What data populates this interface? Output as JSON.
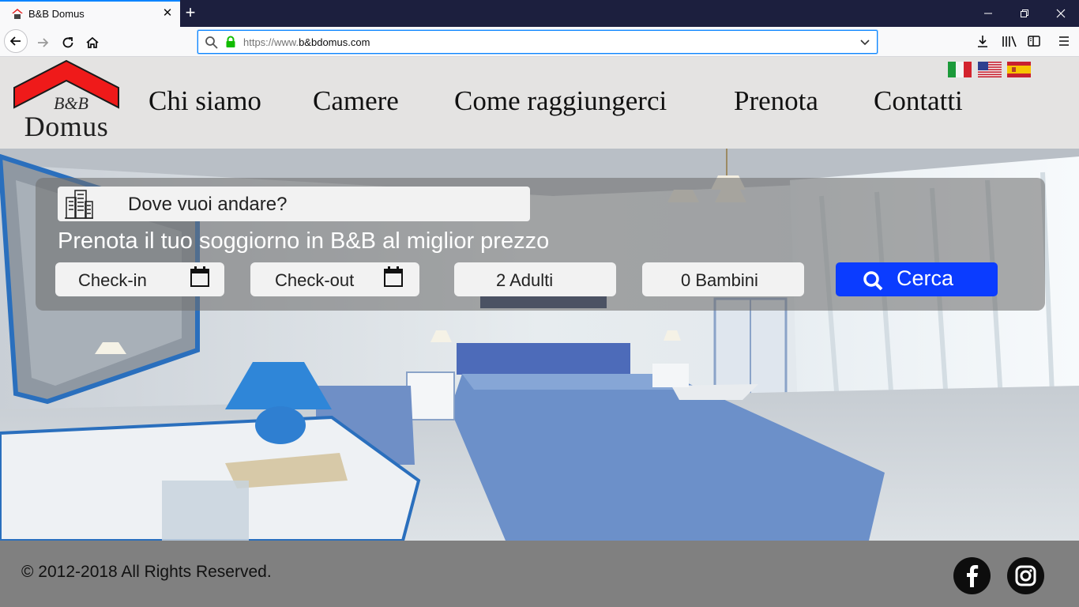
{
  "browser": {
    "tab_title": "B&B Domus",
    "url_prefix": "https://www.",
    "url_domain": "b&bdomus.com",
    "accent": "#0a84ff",
    "titlebar_color": "#1c1f3e"
  },
  "header": {
    "logo_bb": "B&B",
    "logo_name": "Domus",
    "menu": [
      {
        "label": "Chi siamo"
      },
      {
        "label": "Camere"
      },
      {
        "label": "Come raggiungerci"
      },
      {
        "label": "Prenota"
      },
      {
        "label": "Contatti"
      }
    ],
    "languages": [
      "italian-flag",
      "us-flag",
      "spanish-flag"
    ]
  },
  "search": {
    "destination_placeholder": "Dove vuoi andare?",
    "tagline": "Prenota il tuo soggiorno in B&B al miglior prezzo",
    "checkin": "Check-in",
    "checkout": "Check-out",
    "adults": "2 Adulti",
    "children": "0 Bambini",
    "button": "Cerca",
    "button_color": "#0b3cff"
  },
  "footer": {
    "copyright": "© 2012-2018 All Rights Reserved.",
    "social": [
      "facebook-icon",
      "instagram-icon"
    ]
  }
}
